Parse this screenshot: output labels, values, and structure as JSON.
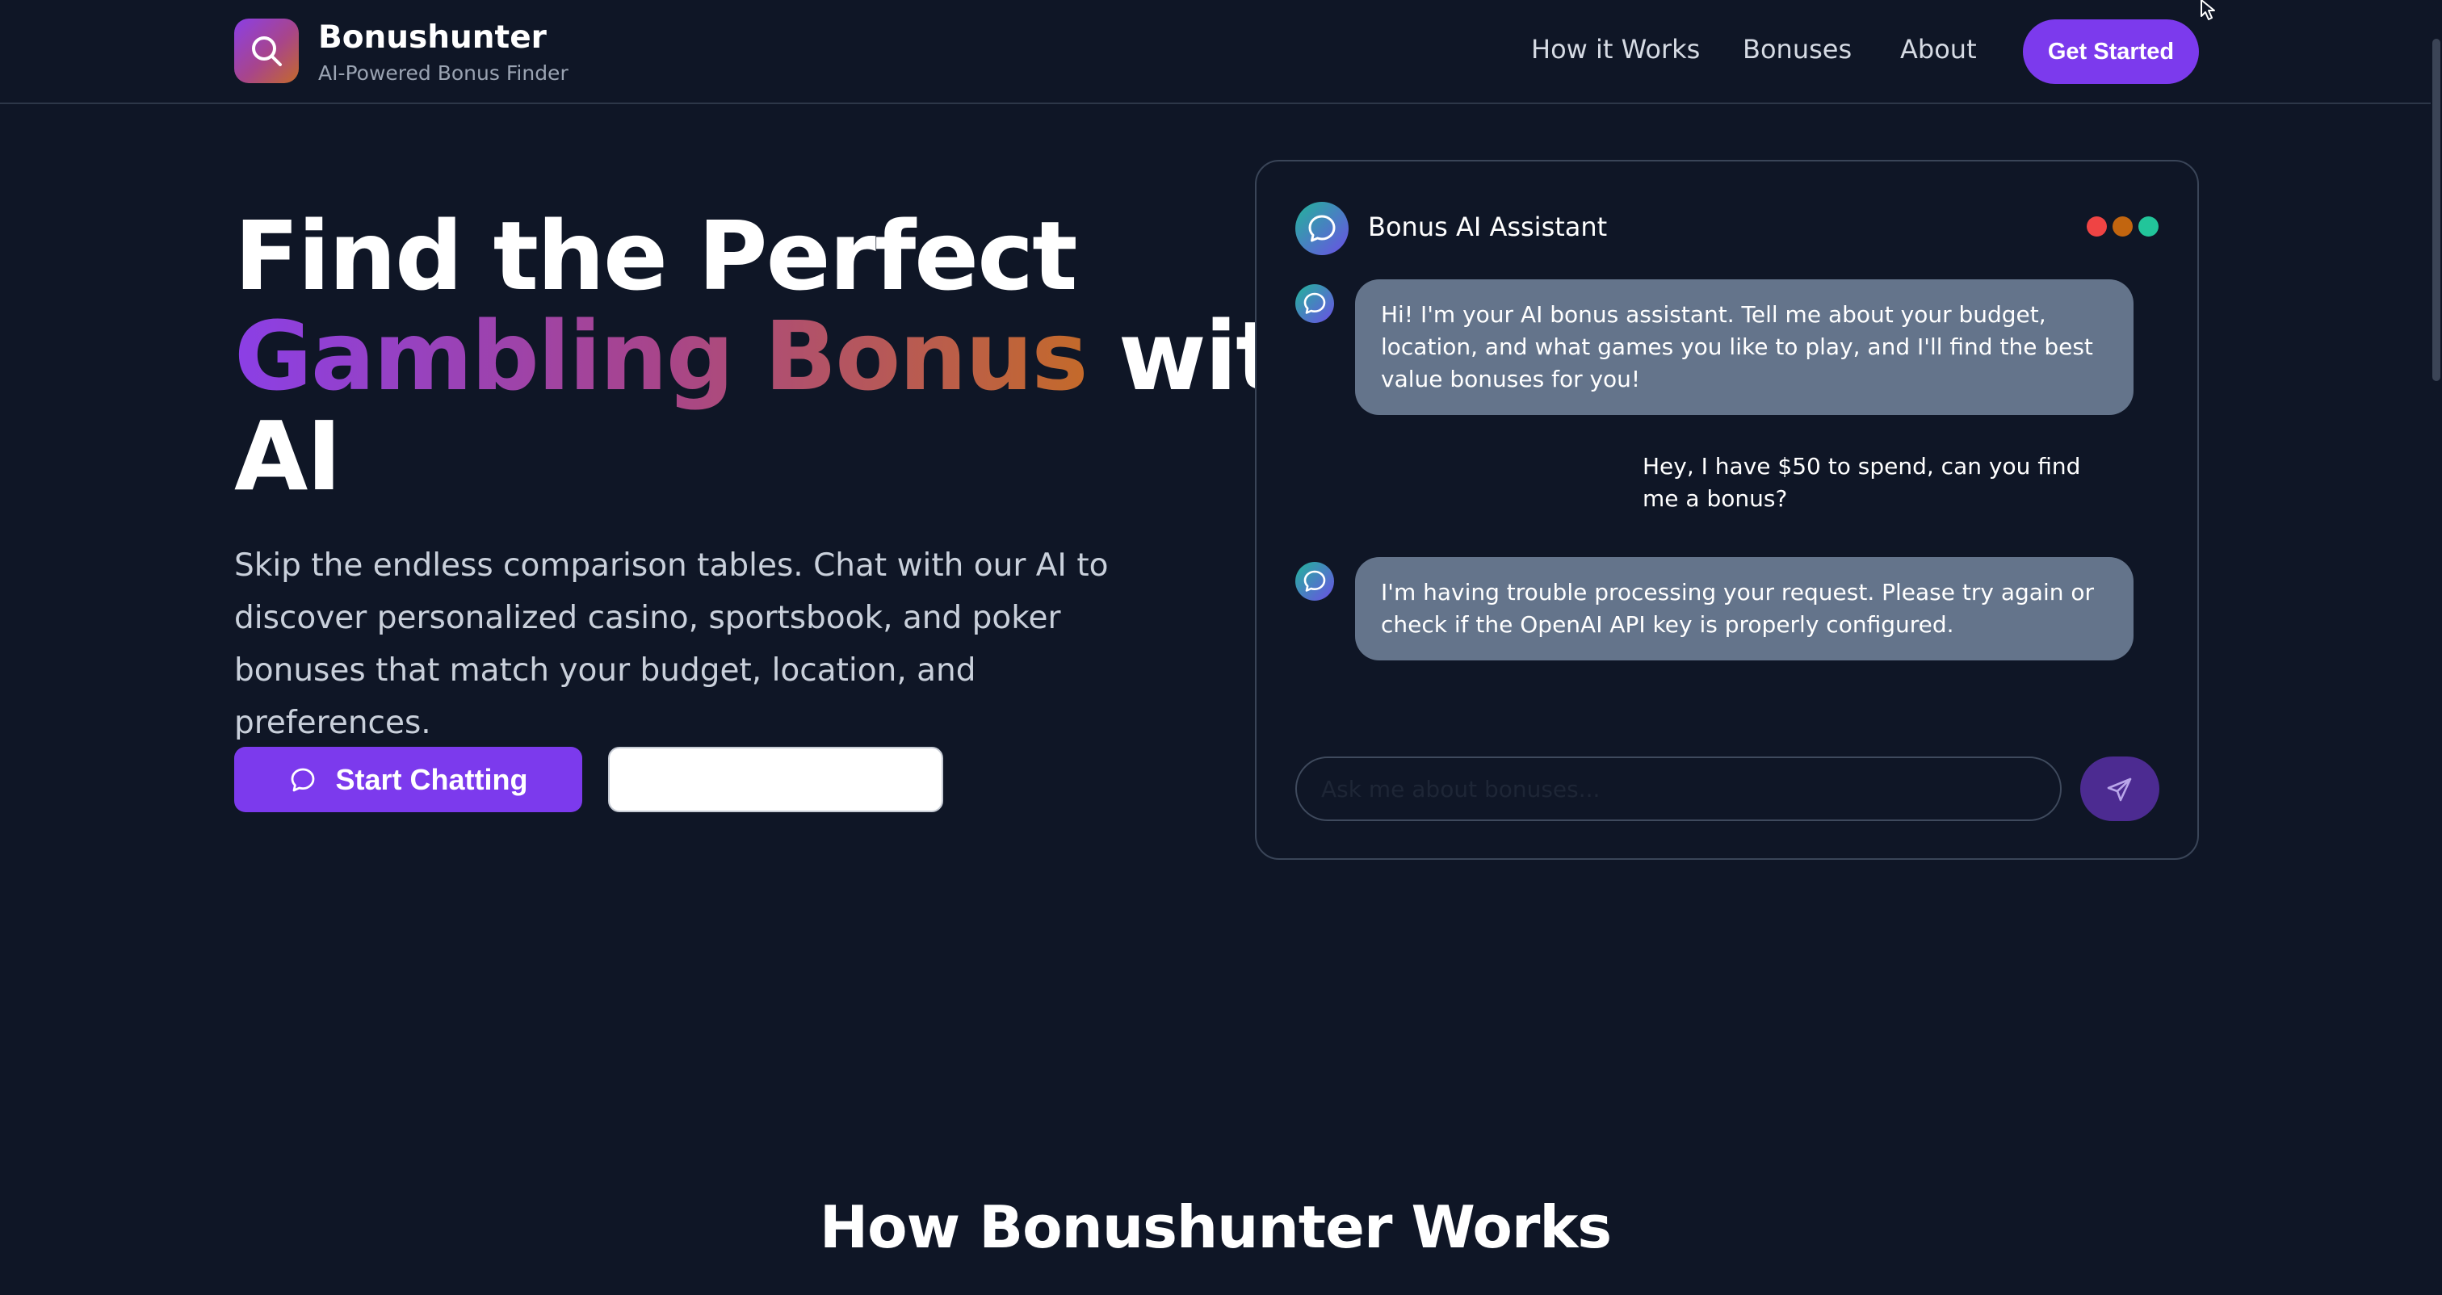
{
  "header": {
    "brand_name": "Bonushunter",
    "brand_tagline": "AI-Powered Bonus Finder",
    "nav": [
      "How it Works",
      "Bonuses",
      "About"
    ],
    "cta_label": "Get Started"
  },
  "hero": {
    "title_line1": "Find the Perfect",
    "title_highlight": "Gambling Bonus",
    "title_line2_rest": " with",
    "title_line3": "AI",
    "subtitle": "Skip the endless comparison tables. Chat with our AI to discover personalized casino, sportsbook, and poker bonuses that match your budget, location, and preferences.",
    "primary_button": "Start Chatting",
    "secondary_button": ""
  },
  "chat": {
    "title": "Bonus AI Assistant",
    "window_dot_colors": [
      "#ef4444",
      "#c2650f",
      "#22c59a"
    ],
    "messages": [
      {
        "role": "assistant",
        "text": "Hi! I'm your AI bonus assistant. Tell me about your budget, location, and what games you like to play, and I'll find the best value bonuses for you!"
      },
      {
        "role": "user",
        "text": "Hey, I have $50 to spend, can you find me a bonus?"
      },
      {
        "role": "assistant",
        "text": "I'm having trouble processing your request. Please try again or check if the OpenAI API key is properly configured."
      }
    ],
    "input_placeholder": "Ask me about bonuses...",
    "send_icon": "send-icon"
  },
  "sections": {
    "how_it_works_title": "How Bonushunter Works"
  },
  "colors": {
    "background": "#0f1626",
    "accent": "#7c3aed",
    "bubble": "#64748b"
  }
}
